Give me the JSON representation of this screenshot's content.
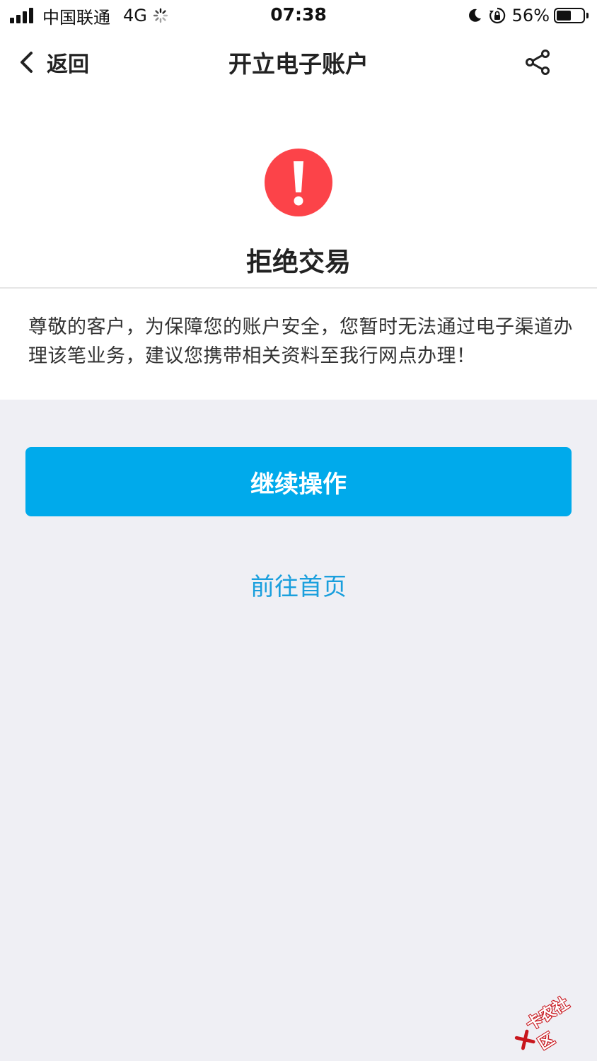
{
  "status_bar": {
    "carrier": "中国联通",
    "network": "4G",
    "time": "07:38",
    "battery": "56%",
    "battery_level": 0.56
  },
  "nav": {
    "back_label": "返回",
    "title": "开立电子账户",
    "share_icon": "share-icon"
  },
  "result": {
    "icon": "alert-icon",
    "icon_color": "#fc4349",
    "title": "拒绝交易",
    "message": "尊敬的客户，为保障您的账户安全，您暂时无法通过电子渠道办理该笔业务，建议您携带相关资料至我行网点办理！"
  },
  "actions": {
    "primary_label": "继续操作",
    "primary_color": "#00aaeb",
    "secondary_label": "前往首页",
    "secondary_color": "#1a9fdd"
  },
  "watermark": {
    "text": "卡农社区"
  }
}
